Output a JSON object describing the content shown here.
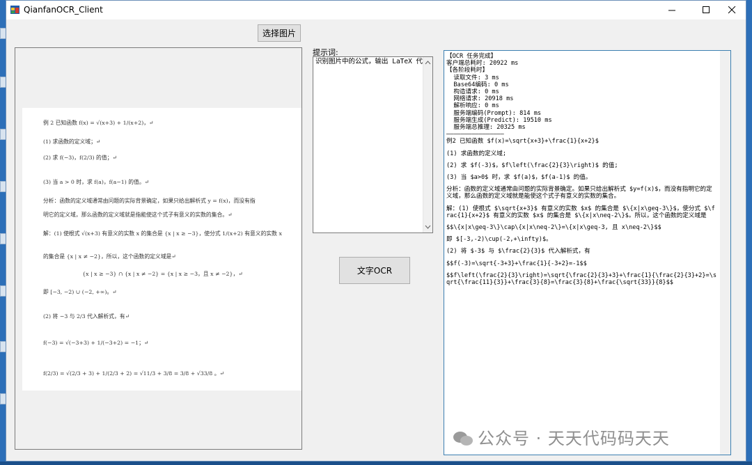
{
  "window": {
    "title": "QianfanOCR_Client",
    "minimize": "—",
    "maximize": "☐",
    "close": "✕",
    "accent": "#3c7fb1"
  },
  "toolbar": {
    "select_image_label": "选择图片"
  },
  "prompt": {
    "label": "提示词:",
    "text": "识别图片中的公式，输出 LaTeX 代码"
  },
  "ocr_button_label": "文字OCR",
  "image_content": {
    "lines": [
      "例 2 已知函数 f(x) = √(x+3) + 1/(x+2)，↵",
      "(1) 求函数的定义域；↵",
      "(2) 求 f(−3)，f(2/3) 的值；↵",
      "(3) 当 a > 0 时，求 f(a)，f(a−1) 的值。↵",
      "分析：函数的定义域通常由问题的实际背景确定，如果只给出解析式 y = f(x)，而没有指",
      "明它的定义域，那么函数的定义域就是指能使这个式子有意义的实数的集合。↵",
      "解：(1) 使根式 √(x+3) 有意义的实数 x 的集合是 {x | x ≥ −3}，使分式 1/(x+2) 有意义的实数 x",
      "的集合是 {x | x ≠ −2}，所以，这个函数的定义域是↵",
      "{x | x ≥ −3} ∩ {x | x ≠ −2} = {x | x ≥ −3，且 x ≠ −2}，↵",
      "即 [−3, −2) ∪ (−2, +∞)。↵",
      "(2) 将 −3 与 2/3 代入解析式，有↵",
      "f(−3) = √(−3+3) + 1/(−3+2) = −1；↵",
      "f(2/3) = √(2/3 + 3) + 1/(2/3 + 2) = √11/3 + 3/8 = 3/8 + √33/8 。↵"
    ]
  },
  "result": {
    "lines": [
      "【OCR 任务完成】",
      "客户端总耗时: 20922 ms",
      "【各阶段耗时】",
      "  读取文件: 3 ms",
      "  Base64编码: 0 ms",
      "  构造请求: 0 ms",
      "  网络请求: 20918 ms",
      "  解析响应: 0 ms",
      "  服务端编码(Prompt): 814 ms",
      "  服务端生成(Predict): 19510 ms",
      "  服务端总推理: 20325 ms",
      "————————————————",
      "例2 已知函数 $f(x)=\\sqrt{x+3}+\\frac{1}{x+2}$",
      "",
      "(1) 求函数的定义域;",
      "",
      "(2) 求 $f(-3)$，$f\\left(\\frac{2}{3}\\right)$ 的值;",
      "",
      "(3) 当 $a>0$ 时，求 $f(a)$，$f(a-1)$ 的值。",
      "",
      "分析：函数的定义域通常由问题的实际背景确定。如果只给出解析式 $y=f(x)$，而没有指明它的定义域，那么函数的定义域就是能使这个式子有意义的实数的集合。",
      "",
      "解：(1) 使根式 $\\sqrt{x+3}$ 有意义的实数 $x$ 的集合是 $\\{x|x\\geq-3\\}$，使分式 $\\frac{1}{x+2}$ 有意义的实数 $x$ 的集合是 $\\{x|x\\neq-2\\}$。所以，这个函数的定义域是",
      "",
      "$$\\{x|x\\geq-3\\}\\cap\\{x|x\\neq-2\\}=\\{x|x\\geq-3, 且 x\\neq-2\\}$$",
      "",
      "即 $[-3,-2)\\cup(-2,+\\infty)$。",
      "",
      "(2) 将 $-3$ 与 $\\frac{2}{3}$ 代入解析式，有",
      "",
      "$$f(-3)=\\sqrt{-3+3}+\\frac{1}{-3+2}=-1$$",
      "",
      "$$f\\left(\\frac{2}{3}\\right)=\\sqrt{\\frac{2}{3}+3}+\\frac{1}{\\frac{2}{3}+2}=\\sqrt{\\frac{11}{3}}+\\frac{3}{8}=\\frac{3}{8}+\\frac{\\sqrt{33}}{8}$$"
    ]
  },
  "watermark": "公众号 · 天天代码码天天"
}
